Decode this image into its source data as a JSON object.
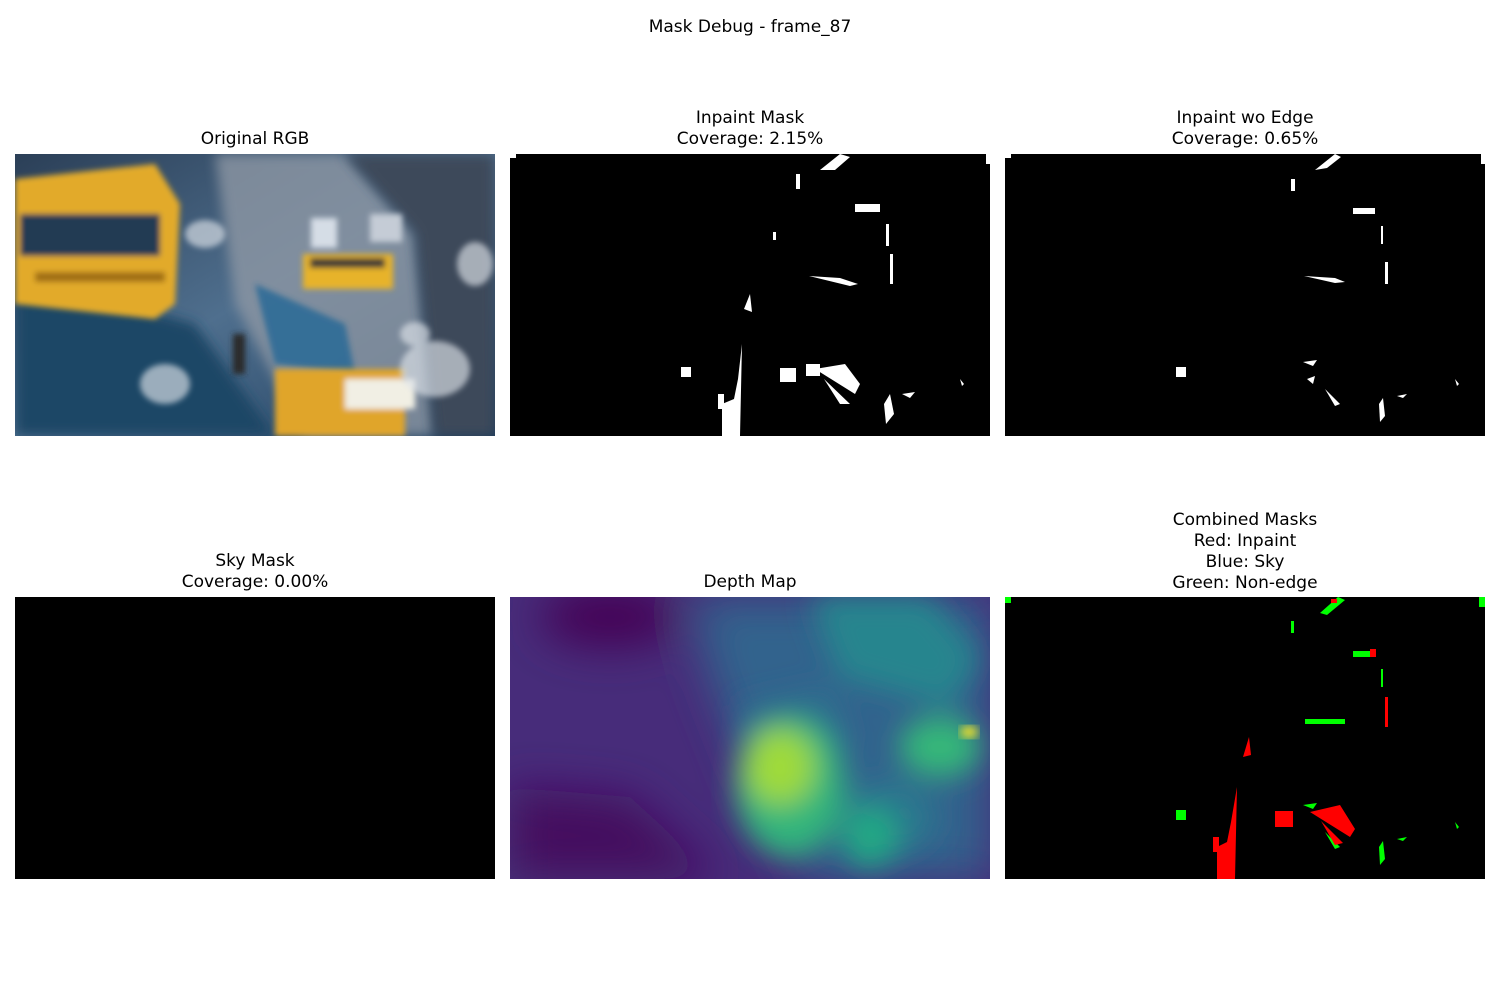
{
  "figure": {
    "title": "Mask Debug - frame_87"
  },
  "panels": {
    "original_rgb": {
      "title": "Original RGB"
    },
    "inpaint_mask": {
      "title": "Inpaint Mask",
      "coverage": "Coverage: 2.15%"
    },
    "inpaint_wo_edge": {
      "title": "Inpaint wo Edge",
      "coverage": "Coverage: 0.65%"
    },
    "sky_mask": {
      "title": "Sky Mask",
      "coverage": "Coverage: 0.00%"
    },
    "depth_map": {
      "title": "Depth Map",
      "colormap": "viridis"
    },
    "combined_masks": {
      "title": "Combined Masks",
      "legend": [
        "Red: Inpaint",
        "Blue: Sky",
        "Green: Non-edge"
      ],
      "colors": {
        "inpaint": "#ff0000",
        "sky": "#0000ff",
        "non_edge": "#00ff00"
      }
    }
  }
}
